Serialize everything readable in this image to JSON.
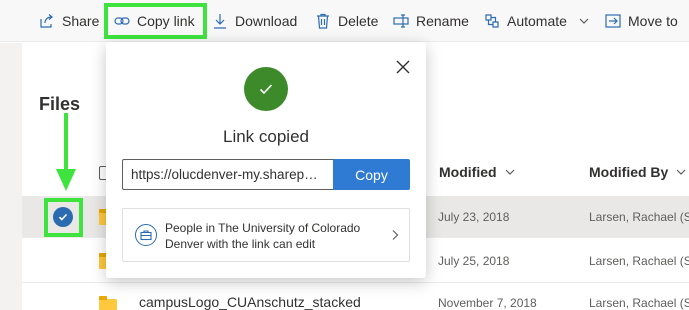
{
  "toolbar": {
    "share": "Share",
    "copy_link": "Copy link",
    "download": "Download",
    "delete": "Delete",
    "rename": "Rename",
    "automate": "Automate",
    "move_to": "Move to"
  },
  "page_title": "Files",
  "columns": {
    "modified": "Modified",
    "modified_by": "Modified By"
  },
  "rows": [
    {
      "name": "",
      "modified": "July 23, 2018",
      "modified_by": "Larsen, Rachael (SC",
      "selected": true
    },
    {
      "name": "",
      "modified": "July 25, 2018",
      "modified_by": "Larsen, Rachael (SC",
      "selected": false
    },
    {
      "name": "campusLogo_CUAnschutz_stacked",
      "modified": "November 7, 2018",
      "modified_by": "Larsen, Rachael (SC",
      "selected": false
    }
  ],
  "popup": {
    "title": "Link copied",
    "link_value": "https://olucdenver-my.sharepoint.com/",
    "copy_button": "Copy",
    "permission_text": "People in The University of Colorado Denver with the link can edit"
  },
  "colors": {
    "highlight": "#3ee33e",
    "accent_blue": "#2f7ad3",
    "success_green": "#3d8a2b",
    "selected_row": "#e9e8e6"
  }
}
